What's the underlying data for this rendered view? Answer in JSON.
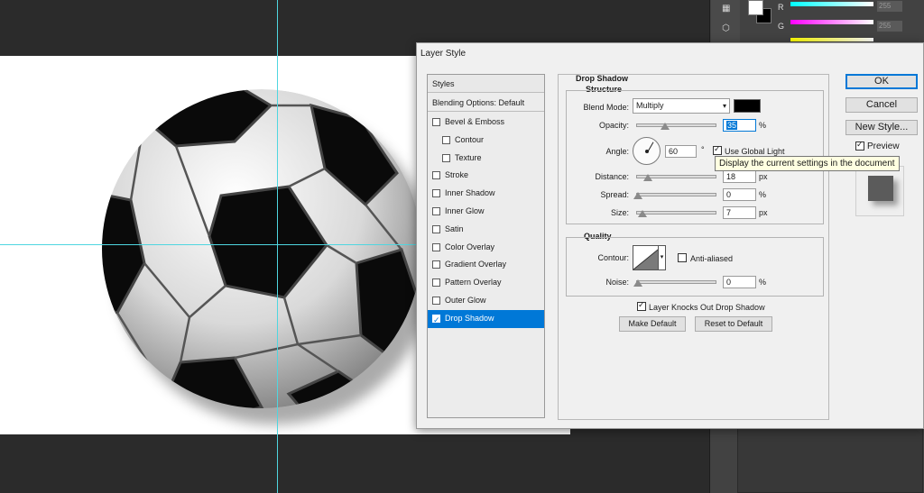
{
  "dialog": {
    "title": "Layer Style",
    "buttons": {
      "ok": "OK",
      "cancel": "Cancel",
      "new_style": "New Style...",
      "preview": "Preview"
    }
  },
  "styles_list": {
    "header": "Styles",
    "blending_options": "Blending Options: Default",
    "items": [
      {
        "label": "Bevel & Emboss",
        "checked": false,
        "indent": false
      },
      {
        "label": "Contour",
        "checked": false,
        "indent": true
      },
      {
        "label": "Texture",
        "checked": false,
        "indent": true
      },
      {
        "label": "Stroke",
        "checked": false,
        "indent": false
      },
      {
        "label": "Inner Shadow",
        "checked": false,
        "indent": false
      },
      {
        "label": "Inner Glow",
        "checked": false,
        "indent": false
      },
      {
        "label": "Satin",
        "checked": false,
        "indent": false
      },
      {
        "label": "Color Overlay",
        "checked": false,
        "indent": false
      },
      {
        "label": "Gradient Overlay",
        "checked": false,
        "indent": false
      },
      {
        "label": "Pattern Overlay",
        "checked": false,
        "indent": false
      },
      {
        "label": "Outer Glow",
        "checked": false,
        "indent": false
      },
      {
        "label": "Drop Shadow",
        "checked": true,
        "indent": false,
        "selected": true
      }
    ]
  },
  "drop_shadow": {
    "section_title": "Drop Shadow",
    "structure": {
      "title": "Structure",
      "blend_mode_label": "Blend Mode:",
      "blend_mode_value": "Multiply",
      "shadow_color": "#000000",
      "opacity_label": "Opacity:",
      "opacity_value": "35",
      "opacity_unit": "%",
      "opacity_level": 35,
      "angle_label": "Angle:",
      "angle_value": "60",
      "angle_unit": "°",
      "use_global_light_label": "Use Global Light",
      "use_global_light": true,
      "distance_label": "Distance:",
      "distance_value": "18",
      "distance_unit": "px",
      "spread_label": "Spread:",
      "spread_value": "0",
      "spread_unit": "%",
      "size_label": "Size:",
      "size_value": "7",
      "size_unit": "px"
    },
    "quality": {
      "title": "Quality",
      "contour_label": "Contour:",
      "anti_aliased_label": "Anti-aliased",
      "anti_aliased": false,
      "noise_label": "Noise:",
      "noise_value": "0",
      "noise_unit": "%"
    },
    "knockout_label": "Layer Knocks Out Drop Shadow",
    "knockout": true,
    "make_default": "Make Default",
    "reset_to_default": "Reset to Default"
  },
  "tooltip": "Display the current settings in the document",
  "color_panel": {
    "channel_r": "R",
    "channel_g": "G",
    "value_r": "255",
    "value_g": "255",
    "foreground": "#ffffff",
    "background": "#000000"
  },
  "colors": {
    "selection": "#0078d7",
    "guide": "#4fd6e0",
    "workspace": "#2b2b2b"
  },
  "canvas": {
    "image": "soccer-ball"
  }
}
